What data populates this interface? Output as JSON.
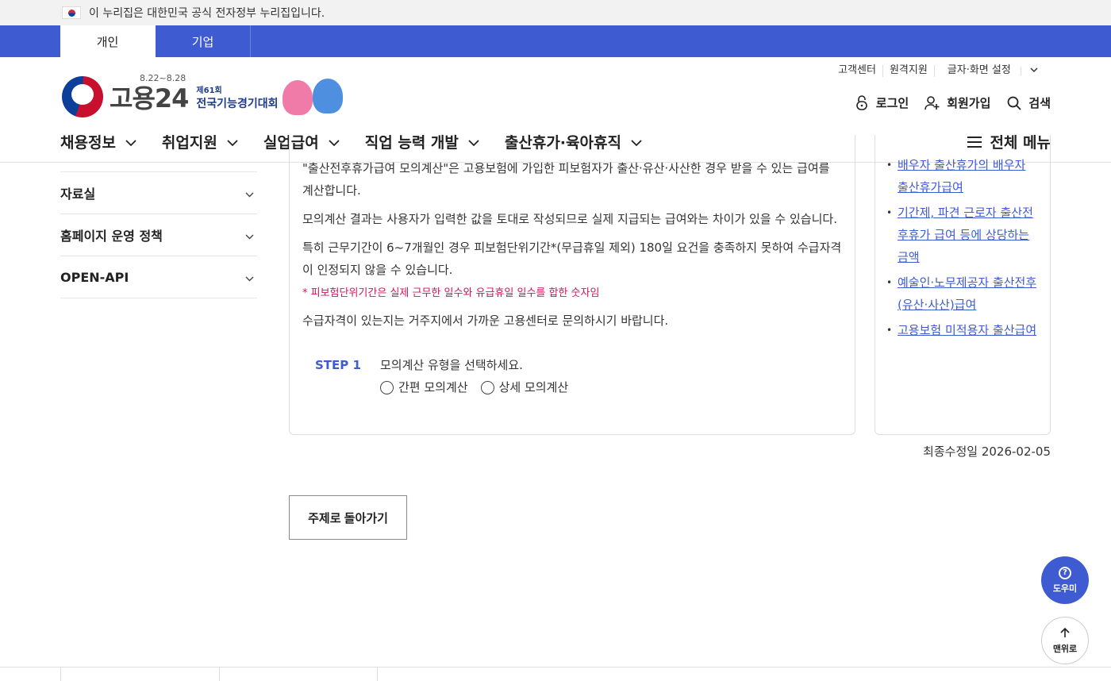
{
  "gov_banner": {
    "text": "이 누리집은 대한민국 공식 전자정부 누리집입니다."
  },
  "user_types": [
    {
      "label": "개인",
      "active": true
    },
    {
      "label": "기업",
      "active": false
    }
  ],
  "logo": {
    "text": "고용24",
    "date": "8.22~8.28",
    "event_small": "제61회",
    "event_title": "전국기능경기대회"
  },
  "util_links": {
    "customer": "고객센터",
    "remote": "원격지원",
    "display": "글자·화면 설정"
  },
  "member_links": {
    "login": "로그인",
    "signup": "회원가입",
    "search": "검색"
  },
  "gnb": [
    "채용정보",
    "취업지원",
    "실업급여",
    "직업 능력 개발",
    "출산휴가·육아휴직"
  ],
  "all_menu": "전체 메뉴",
  "left_menu": [
    "자료실",
    "홈페이지 운영 정책",
    "OPEN-API"
  ],
  "content": {
    "p1": "\"출산전후휴가급여 모의계산\"은 고용보험에 가입한 피보험자가 출산·유산·사산한 경우 받을 수 있는 급여를 계산합니다.",
    "p2": "모의계산 결과는 사용자가 입력한 값을 토대로 작성되므로 실제 지급되는 급여와는 차이가 있을 수 있습니다.",
    "p3": "특히 근무기간이 6~7개월인 경우 피보험단위기간*(무급휴일 제외) 180일 요건을 충족하지 못하여 수급자격이 인정되지 않을 수 있습니다.",
    "note": "* 피보험단위기간은 실제 근무한 일수와 유급휴일 일수를 합한 숫자임",
    "p4": "수급자격이 있는지는 거주지에서 가까운 고용센터로 문의하시기 바랍니다.",
    "step_label": "STEP 1",
    "step_text": "모의계산 유형을 선택하세요.",
    "radio_simple": "간편 모의계산",
    "radio_detail": "상세 모의계산"
  },
  "related": [
    "배우자 출산휴가의 배우자 출산휴가급여",
    "기간제, 파견 근로자 출산전후휴가 급여 등에 상당하는 금액",
    "예술인·노무제공자 출산전후(유산·사산)급여",
    "고용보험 미적용자 출산급여"
  ],
  "last_modified": "최종수정일 2026-02-05",
  "back_button": "주제로 돌아가기",
  "help_button": "도우미",
  "top_button": "맨위로",
  "colors": {
    "primary": "#3e5bd1",
    "note": "#d4145a"
  }
}
